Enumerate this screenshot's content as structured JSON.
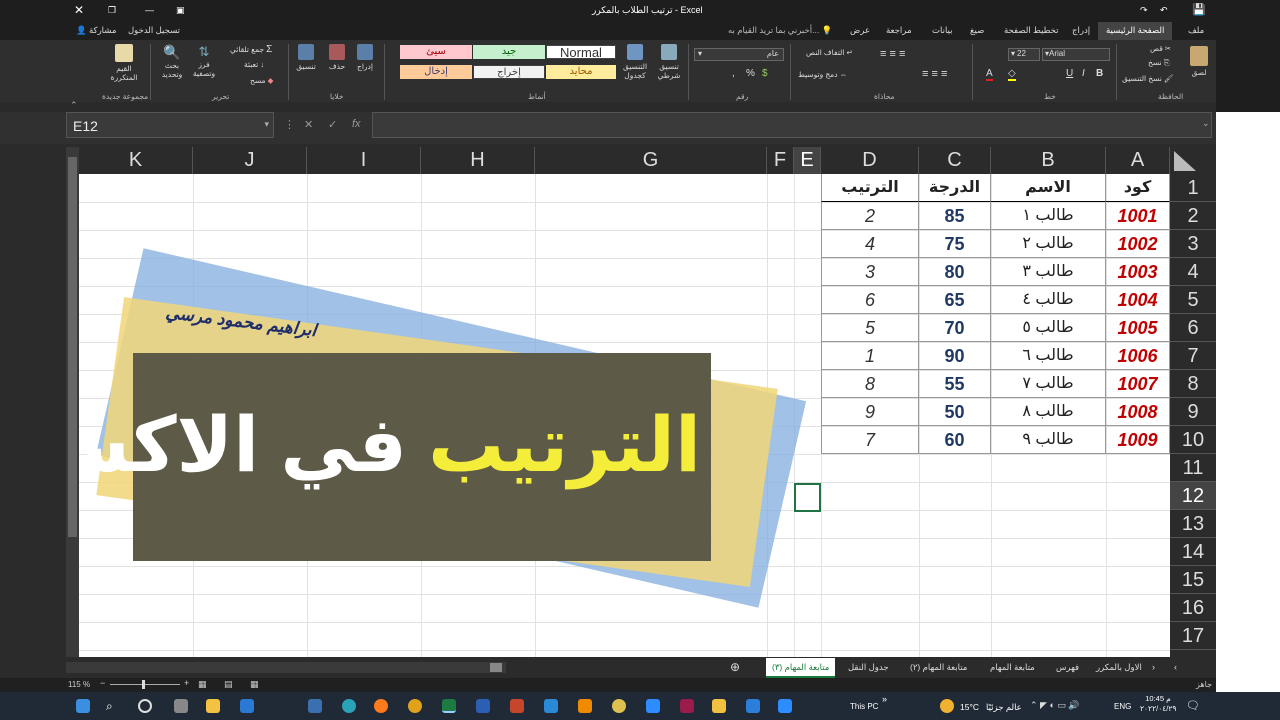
{
  "title_bar": {
    "title": "ترتيب الطلاب بالمكرر - Excel",
    "search_hint": "أخبرني بما تريد القيام به...",
    "sign_in": "تسجيل الدخول",
    "share": "مشاركة"
  },
  "tabs": [
    "ملف",
    "الصفحة الرئيسية",
    "إدراج",
    "تخطيط الصفحة",
    "صيغ",
    "بيانات",
    "مراجعة",
    "عرض"
  ],
  "ribbon": {
    "clipboard": {
      "label": "الحافظة",
      "paste": "لصق",
      "cut": "قص",
      "copy": "نسخ",
      "format_painter": "نسخ التنسيق"
    },
    "font": {
      "label": "خط",
      "name": "Arial",
      "size": "22"
    },
    "alignment": {
      "label": "محاذاة",
      "wrap": "التفاف النص",
      "merge": "دمج وتوسيط"
    },
    "number": {
      "label": "رقم",
      "format": "عام"
    },
    "styles": {
      "label": "أنماط",
      "conditional": "تنسيق شرطي",
      "format_table": "التنسيق كجدول",
      "cells": [
        "Normal",
        "جيد",
        "سيئ",
        "محايد",
        "إخراج",
        "إدخال"
      ]
    },
    "cells_group": {
      "label": "خلايا",
      "insert": "إدراج",
      "delete": "حذف",
      "format": "تنسيق"
    },
    "editing": {
      "label": "تحرير",
      "autosum": "جمع تلقائي",
      "fill": "تعبئة",
      "clear": "مسح",
      "sort": "فرز وتصفية",
      "find": "بحث وتحديد"
    },
    "new_group": {
      "label": "مجموعة جديدة",
      "button": "القيم المتكررة"
    }
  },
  "formula_bar": {
    "name_box": "E12",
    "formula": ""
  },
  "columns": [
    "A",
    "B",
    "C",
    "D",
    "E",
    "F",
    "G",
    "H",
    "I",
    "J",
    "K"
  ],
  "rows": [
    "1",
    "2",
    "3",
    "4",
    "5",
    "6",
    "7",
    "8",
    "9",
    "10",
    "11",
    "12",
    "13",
    "14",
    "15",
    "16",
    "17"
  ],
  "table": {
    "headers": [
      "كود",
      "الاسم",
      "الدرجة",
      "الترتيب"
    ],
    "rows": [
      [
        "1001",
        "طالب ١",
        "85",
        "2"
      ],
      [
        "1002",
        "طالب ٢",
        "75",
        "4"
      ],
      [
        "1003",
        "طالب ٣",
        "80",
        "3"
      ],
      [
        "1004",
        "طالب ٤",
        "65",
        "6"
      ],
      [
        "1005",
        "طالب ٥",
        "70",
        "5"
      ],
      [
        "1006",
        "طالب ٦",
        "90",
        "1"
      ],
      [
        "1007",
        "طالب ٧",
        "55",
        "8"
      ],
      [
        "1008",
        "طالب ٨",
        "50",
        "9"
      ],
      [
        "1009",
        "طالب ٩",
        "60",
        "7"
      ]
    ]
  },
  "overlay": {
    "author": "ابراهيم محمود مرسي",
    "title_yellow": "الترتيب",
    "title_white": "في الاكسل"
  },
  "sheet_tabs": [
    "الاول بالمكرر",
    "فهرس",
    "متابعة المهام",
    "متابعة المهام (٢)",
    "جدول النقل",
    "متابعة المهام (٣)"
  ],
  "status": {
    "ready": "جاهز",
    "zoom": "115 %"
  },
  "taskbar": {
    "this_pc": "This PC",
    "weather": "عالم جزئيًا",
    "temp": "15°C",
    "lang": "ENG",
    "time": "10:45 م",
    "date": "٢٠٢٢/٠٤/٢٩"
  },
  "colors": {
    "accent_green": "#1a7a3a",
    "code_red": "#c00000",
    "score_navy": "#1f3864"
  }
}
